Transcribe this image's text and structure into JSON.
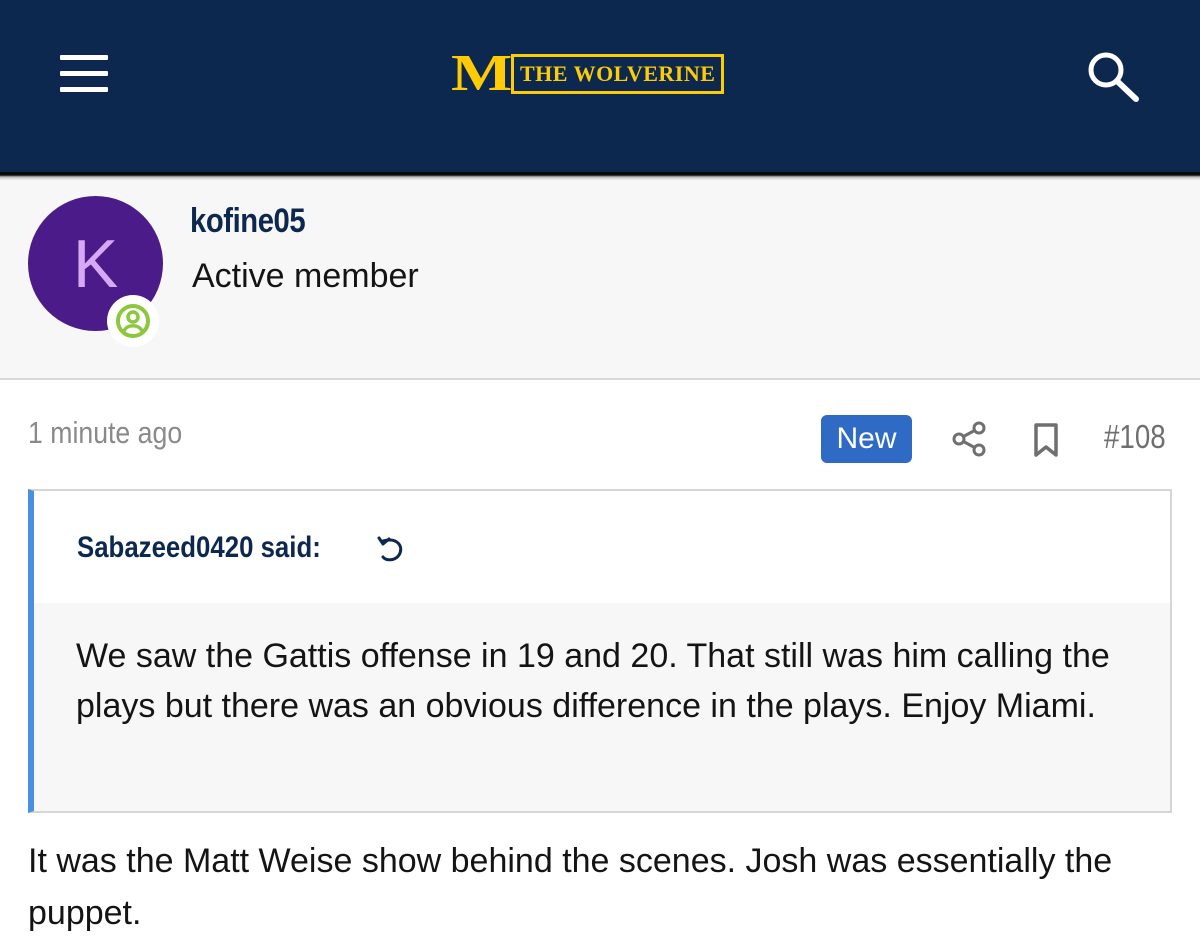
{
  "header": {
    "logo_mark": "M",
    "logo_text": "THE WOLVERINE",
    "menu_icon": "hamburger-menu-icon",
    "search_icon": "search-icon",
    "background_color": "#0d284f",
    "accent_color": "#ffcb05"
  },
  "author": {
    "avatar_letter": "K",
    "avatar_color": "#4b1b89",
    "username": "kofine05",
    "title": "Active member",
    "status_icon": "user-circle-icon",
    "status_color": "#8dc63f"
  },
  "post": {
    "timestamp": "1 minute ago",
    "new_badge": "New",
    "post_number": "#108",
    "share_icon": "share-icon",
    "bookmark_icon": "bookmark-icon",
    "quote": {
      "author_said": "Sabazeed0420 said:",
      "jump_icon": "jump-to-quote-icon",
      "text": "We saw the Gattis offense in 19 and 20. That still was him calling the plays but there was an obvious difference in the plays. Enjoy Miami."
    },
    "body": "It was the Matt Weise show behind the scenes. Josh was essentially the puppet."
  }
}
